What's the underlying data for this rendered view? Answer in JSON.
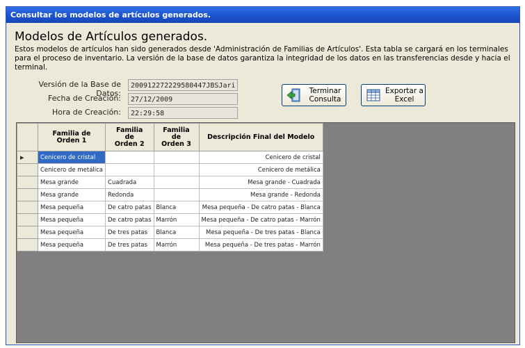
{
  "window": {
    "title": "Consultar los modelos de artículos generados."
  },
  "header": {
    "title": "Modelos de Artículos generados.",
    "description": "Estos modelos de artículos han sido generados desde 'Administración de Familias de Artículos'. Esta tabla se cargará en los terminales para el proceso de inventario. La versión de la base de datos garantiza la integridad de los datos en las transferencias desde y hacia el terminal."
  },
  "info": {
    "version_label": "Versión de la Base de Datos:",
    "version_value": "200912272229580447JBSJari",
    "fecha_label": "Fecha de Creación:",
    "fecha_value": "27/12/2009",
    "hora_label": "Hora de Creación:",
    "hora_value": "22:29:58"
  },
  "buttons": {
    "terminar": [
      "Terminar",
      "Consulta"
    ],
    "exportar": [
      "Exportar a",
      "Excel"
    ]
  },
  "grid": {
    "columns": [
      [
        "Familia de",
        "Orden 1"
      ],
      [
        "Familia",
        "de",
        "Orden 2"
      ],
      [
        "Familia",
        "de",
        "Orden 3"
      ],
      [
        "Descripción Final del Modelo"
      ]
    ],
    "rows": [
      [
        "Cenicero de cristal",
        "",
        "",
        "Cenicero de cristal"
      ],
      [
        "Cenicero de metálica",
        "",
        "",
        "Cenicero de metálica"
      ],
      [
        "Mesa grande",
        "Cuadrada",
        "",
        "Mesa grande - Cuadrada"
      ],
      [
        "Mesa grande",
        "Redonda",
        "",
        "Mesa grande - Redonda"
      ],
      [
        "Mesa pequeña",
        "De catro patas",
        "Blanca",
        "Mesa pequeña - De catro patas - Blanca"
      ],
      [
        "Mesa pequeña",
        "De catro patas",
        "Marrón",
        "Mesa pequeña - De catro patas - Marrón"
      ],
      [
        "Mesa pequeña",
        "De tres patas",
        "Blanca",
        "Mesa pequeña - De tres patas - Blanca"
      ],
      [
        "Mesa pequeña",
        "De tres patas",
        "Marrón",
        "Mesa pequeña - De tres patas - Marrón"
      ]
    ],
    "selected_row": 0,
    "current_row_indicator": "▶"
  },
  "colors": {
    "titlebar": "#1c52cf",
    "selection": "#316ac5",
    "grid_background": "#808080"
  }
}
